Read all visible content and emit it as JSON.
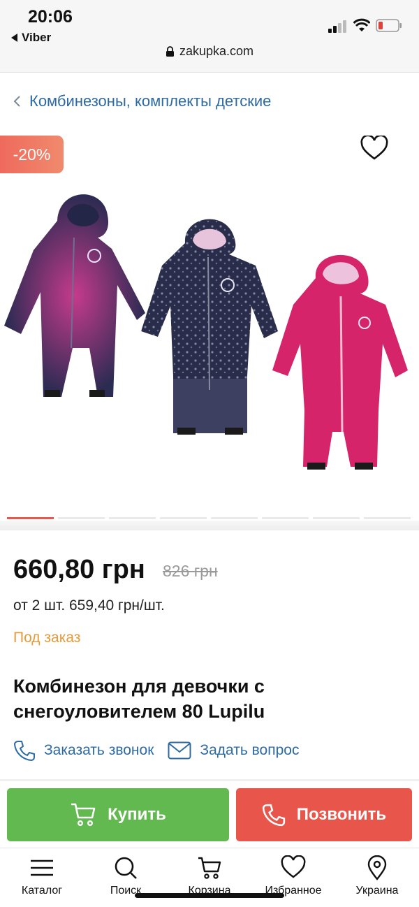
{
  "status_bar": {
    "time": "20:06",
    "back_app": "Viber",
    "url": "zakupka.com"
  },
  "breadcrumb": {
    "label": "Комбинезоны, комплекты детские"
  },
  "gallery": {
    "discount_badge": "-20%",
    "slide_count": 8,
    "active_slide": 1
  },
  "product": {
    "price": "660,80 грн",
    "old_price": "826 грн",
    "bulk_price": "от 2 шт. 659,40 грн/шт.",
    "availability": "Под заказ",
    "title": "Комбинезон для девочки с снегоуловителем 80 Lupilu"
  },
  "contacts": {
    "callback": "Заказать звонок",
    "question": "Задать вопрос"
  },
  "actions": {
    "buy": "Купить",
    "call": "Позвонить"
  },
  "tabbar": {
    "catalog": "Каталог",
    "search": "Поиск",
    "cart": "Корзина",
    "favorites": "Избранное",
    "region": "Украина"
  },
  "colors": {
    "link_blue": "#2d6aa3",
    "buy_green": "#61b94f",
    "call_red": "#e8554b",
    "availability_orange": "#e59a3c",
    "badge_red": "#ef6a5c"
  }
}
